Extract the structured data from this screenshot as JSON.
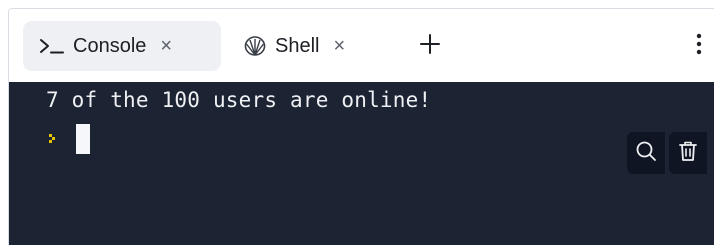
{
  "tabs": [
    {
      "label": "Console",
      "icon": "console-prompt-icon",
      "close": "×",
      "active": true
    },
    {
      "label": "Shell",
      "icon": "shell-icon",
      "close": "×",
      "active": false
    }
  ],
  "add_tab": {
    "icon": "plus-icon"
  },
  "menu": {
    "icon": "kebab-menu-icon"
  },
  "console": {
    "output": "7 of the 100 users are online!",
    "prompt_icon": "prompt-chevron-icon",
    "prompt_color": "#e5c100",
    "background": "#1c2333"
  },
  "toolbar": {
    "search_icon": "search-icon",
    "clear_icon": "trash-icon"
  }
}
